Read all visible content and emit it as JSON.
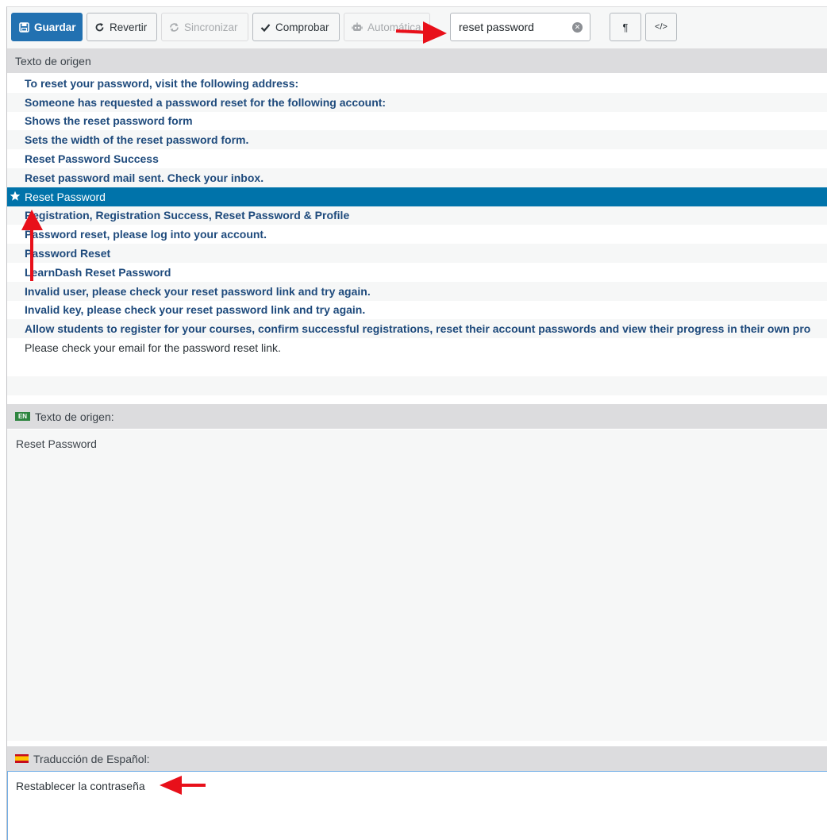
{
  "toolbar": {
    "save_label": "Guardar",
    "revert_label": "Revertir",
    "sync_label": "Sincronizar",
    "check_label": "Comprobar",
    "auto_label": "Automática",
    "search_value": "reset password",
    "pilcrow_label": "¶",
    "code_label": "</>"
  },
  "list_header": "Texto de origen",
  "list": {
    "items": [
      "To reset your password, visit the following address:",
      "Someone has requested a password reset for the following account:",
      "Shows the reset password form",
      "Sets the width of the reset password form.",
      "Reset Password Success",
      "Reset password mail sent. Check your inbox.",
      "Reset Password",
      "Registration, Registration Success, Reset Password & Profile",
      "Password reset, please log into your account.",
      "Password Reset",
      "LearnDash Reset Password",
      "Invalid user, please check your reset password link and try again.",
      "Invalid key, please check your reset password link and try again.",
      "Allow students to register for your courses, confirm successful registrations, reset their account passwords and view their progress in their own pro",
      "Please check your email for the password reset link."
    ]
  },
  "source": {
    "lang_badge": "EN",
    "header": "Texto de origen:",
    "text": "Reset Password"
  },
  "translation": {
    "header": "Traducción de Español:",
    "value": "Restablecer la contraseña"
  },
  "colors": {
    "primary": "#2271b1",
    "selected_row": "#0073aa",
    "link_text": "#1e4a7c",
    "annotation_arrow": "#e8101a"
  }
}
